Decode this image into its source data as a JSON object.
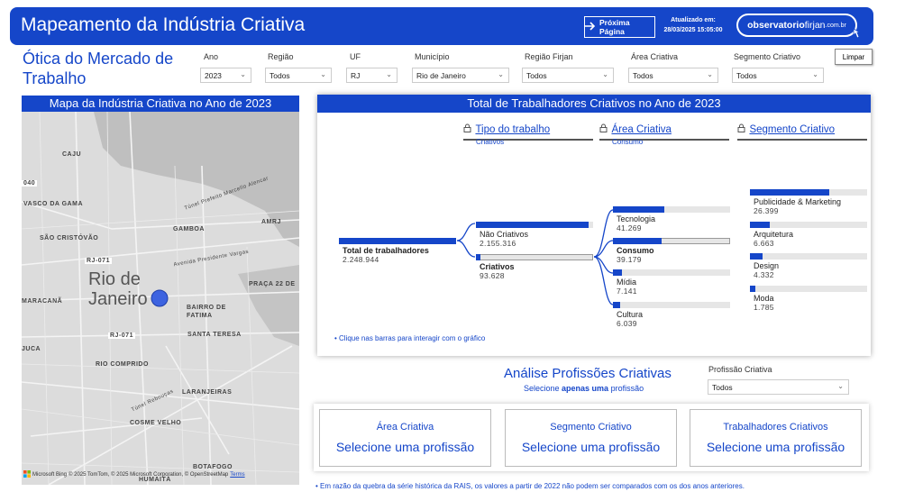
{
  "header": {
    "title": "Mapeamento da Indústria Criativa",
    "next_button": "Próxima Página",
    "updated_label": "Atualizado em:",
    "updated_date": "28/03/2025 15:05:00",
    "logo_main": "observatorio",
    "logo_brand": "firjan",
    "logo_domain": ".com.br"
  },
  "page_subtitle": "Ótica do Mercado de Trabalho",
  "filters": [
    {
      "label": "Ano",
      "value": "2023"
    },
    {
      "label": "Região",
      "value": "Todos"
    },
    {
      "label": "UF",
      "value": "RJ"
    },
    {
      "label": "Município",
      "value": "Rio de Janeiro"
    },
    {
      "label": "Região Firjan",
      "value": "Todos"
    },
    {
      "label": "Área Criativa",
      "value": "Todos"
    },
    {
      "label": "Segmento Criativo",
      "value": "Todos"
    }
  ],
  "clear_button": "Limpar",
  "map": {
    "title": "Mapa da Indústria Criativa no Ano de 2023",
    "city": "Rio de Janeiro",
    "city_line1": "Rio de",
    "city_line2": "Janeiro",
    "labels": [
      "CAJU",
      "040",
      "VASCO DA GAMA",
      "SÃO CRISTÓVÃO",
      "GAMBOA",
      "AMRJ",
      "RJ-071",
      "MARACANÃ",
      "PRAÇA 22 DE",
      "BAIRRO DE FATIMA",
      "SANTA TERESA",
      "RJ-071",
      "JUCA",
      "RIO COMPRIDO",
      "LARANJEIRAS",
      "COSME VELHO",
      "BOTAFOGO",
      "HUMAITÁ",
      "Túnel Prefeito Marcello Alencar",
      "Avenida Presidente Vargas",
      "Túnel Rebouças"
    ],
    "attribution": "© 2025 TomTom, © 2025 Microsoft Corporation, © OpenStreetMap",
    "terms": "Terms",
    "bing": "Microsoft Bing"
  },
  "sankey": {
    "title": "Total de Trabalhadores Criativos no Ano de 2023",
    "levels": [
      {
        "name": "Tipo do trabalho",
        "selected": "Criativos"
      },
      {
        "name": "Área Criativa",
        "selected": "Consumo"
      },
      {
        "name": "Segmento Criativo",
        "selected": ""
      }
    ],
    "root": {
      "label": "Total de trabalhadores",
      "value": "2.248.944"
    },
    "tipo": [
      {
        "label": "Não Criativos",
        "value": "2.155.316",
        "fraction": 0.958
      },
      {
        "label": "Criativos",
        "value": "93.628",
        "fraction": 0.042
      }
    ],
    "area": [
      {
        "label": "Tecnologia",
        "value": "41.269",
        "fraction": 0.441
      },
      {
        "label": "Consumo",
        "value": "39.179",
        "fraction": 0.418
      },
      {
        "label": "Mídia",
        "value": "7.141",
        "fraction": 0.076
      },
      {
        "label": "Cultura",
        "value": "6.039",
        "fraction": 0.064
      }
    ],
    "segmento": [
      {
        "label": "Publicidade & Marketing",
        "value": "26.399",
        "fraction": 0.674
      },
      {
        "label": "Arquitetura",
        "value": "6.663",
        "fraction": 0.17
      },
      {
        "label": "Design",
        "value": "4.332",
        "fraction": 0.111
      },
      {
        "label": "Moda",
        "value": "1.785",
        "fraction": 0.046
      }
    ],
    "hint": "• Clique nas barras para interagir com o gráfico"
  },
  "analysis": {
    "title": "Análise Profissões Criativas",
    "subtitle_pre": "Selecione ",
    "subtitle_bold": "apenas uma",
    "subtitle_post": " profissão",
    "prof_label": "Profissão Criativa",
    "prof_value": "Todos",
    "cards": [
      {
        "title": "Área Criativa",
        "value": "Selecione uma profissão"
      },
      {
        "title": "Segmento Criativo",
        "value": "Selecione uma profissão"
      },
      {
        "title": "Trabalhadores Criativos",
        "value": "Selecione uma profissão"
      }
    ]
  },
  "footnote": "• Em razão da quebra da série histórica da RAIS, os valores a partir de 2022 não podem ser comparados com os dos anos anteriores.",
  "colors": {
    "brand": "#1546c9",
    "bar_bg": "#e6e6e6"
  }
}
